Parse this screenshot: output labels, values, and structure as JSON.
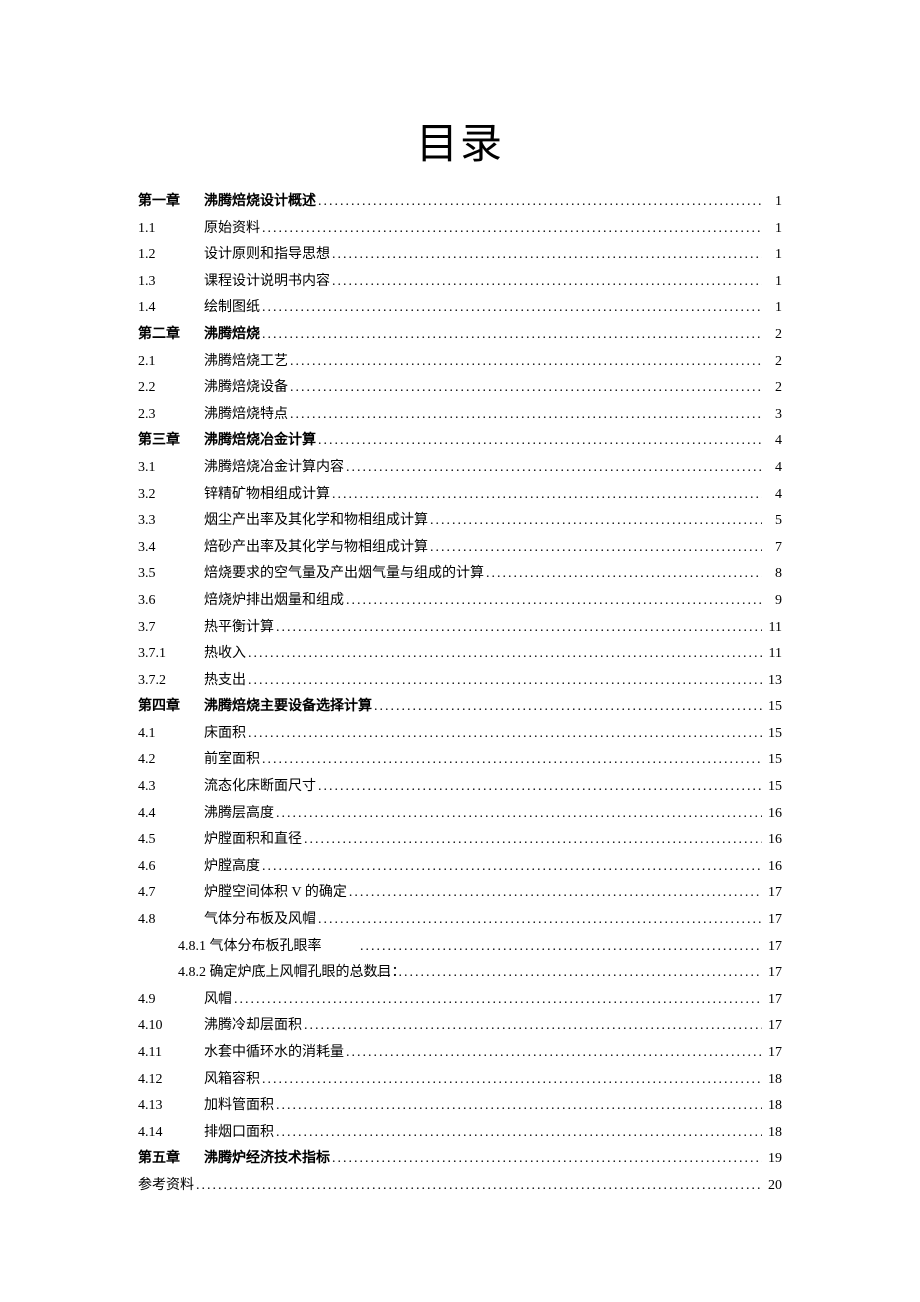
{
  "title": "目录",
  "entries": [
    {
      "num": "第一章",
      "text": "沸腾焙烧设计概述",
      "page": "1",
      "bold": true
    },
    {
      "num": "1.1",
      "text": "原始资料",
      "page": "1"
    },
    {
      "num": "1.2",
      "text": "设计原则和指导思想",
      "page": "1"
    },
    {
      "num": "1.3",
      "text": "课程设计说明书内容",
      "page": "1"
    },
    {
      "num": "1.4",
      "text": "绘制图纸",
      "page": "1"
    },
    {
      "num": "第二章",
      "text": "沸腾焙烧",
      "page": "2",
      "bold": true
    },
    {
      "num": "2.1",
      "text": "沸腾焙烧工艺",
      "page": "2"
    },
    {
      "num": "2.2",
      "text": "沸腾焙烧设备",
      "page": "2"
    },
    {
      "num": "2.3",
      "text": "沸腾焙烧特点",
      "page": "3"
    },
    {
      "num": "第三章",
      "text": "沸腾焙烧冶金计算",
      "page": "4",
      "bold": true
    },
    {
      "num": "3.1",
      "text": "沸腾焙烧冶金计算内容",
      "page": "4"
    },
    {
      "num": "3.2",
      "text": "锌精矿物相组成计算",
      "page": "4"
    },
    {
      "num": "3.3",
      "text": "烟尘产出率及其化学和物相组成计算",
      "page": "5"
    },
    {
      "num": "3.4",
      "text": "焙砂产出率及其化学与物相组成计算",
      "page": "7"
    },
    {
      "num": "3.5",
      "text": "焙烧要求的空气量及产出烟气量与组成的计算",
      "page": "8"
    },
    {
      "num": "3.6",
      "text": "焙烧炉排出烟量和组成",
      "page": "9"
    },
    {
      "num": "3.7",
      "text": "热平衡计算",
      "page": "11"
    },
    {
      "num": "3.7.1",
      "text": "热收入",
      "page": "11"
    },
    {
      "num": "3.7.2",
      "text": "热支出",
      "page": "13"
    },
    {
      "num": "第四章",
      "text": "沸腾焙烧主要设备选择计算",
      "page": "15",
      "bold": true
    },
    {
      "num": "4.1",
      "text": "床面积",
      "page": "15"
    },
    {
      "num": "4.2",
      "text": "前室面积",
      "page": "15"
    },
    {
      "num": "4.3",
      "text": "流态化床断面尺寸",
      "page": "15"
    },
    {
      "num": "4.4",
      "text": "沸腾层高度",
      "page": "16"
    },
    {
      "num": "4.5",
      "text": "炉膛面积和直径",
      "page": "16"
    },
    {
      "num": "4.6",
      "text": "炉膛高度",
      "page": "16"
    },
    {
      "num": "4.7",
      "text": "炉膛空间体积 V 的确定",
      "page": "17"
    },
    {
      "num": "4.8",
      "text": "气体分布板及风帽",
      "page": "17"
    },
    {
      "num": "4.8.1 气体分布板孔眼率",
      "text": "",
      "page": "17",
      "sub": true
    },
    {
      "num": "4.8.2 确定炉底上风帽孔眼的总数目：",
      "text": "",
      "page": "17",
      "sub": true
    },
    {
      "num": "4.9",
      "text": "风帽",
      "page": "17"
    },
    {
      "num": "4.10",
      "text": "沸腾冷却层面积",
      "page": "17"
    },
    {
      "num": "4.11",
      "text": "水套中循环水的消耗量",
      "page": "17"
    },
    {
      "num": "4.12",
      "text": "风箱容积",
      "page": "18"
    },
    {
      "num": "4.13",
      "text": "加料管面积",
      "page": "18"
    },
    {
      "num": "4.14",
      "text": "排烟口面积",
      "page": "18"
    },
    {
      "num": "第五章",
      "text": "沸腾炉经济技术指标",
      "page": "19",
      "bold": true
    },
    {
      "num": "参考资料",
      "text": "",
      "page": "20",
      "nonum_text": true
    }
  ]
}
